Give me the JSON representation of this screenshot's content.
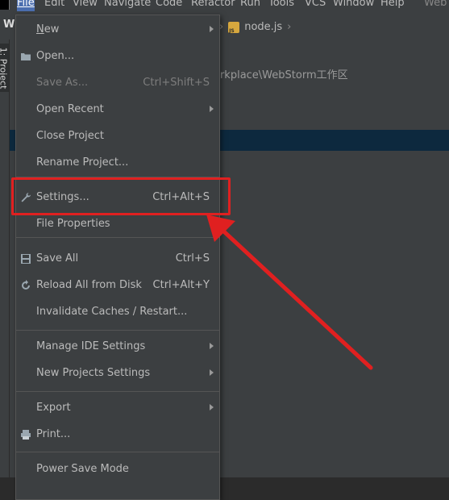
{
  "menubar": {
    "items": [
      "File",
      "Edit",
      "View",
      "Navigate",
      "Code",
      "Refactor",
      "Run",
      "Tools",
      "VCS",
      "Window",
      "Help"
    ],
    "app_title_fragment": "Web"
  },
  "toolbar": {
    "project_letter": "W",
    "breadcrumb_file": "node.js"
  },
  "tool_window": {
    "project_tab": "1: Project"
  },
  "project_panel": {
    "path_fragment": "orkplace\\WebStorm工作区"
  },
  "file_menu": {
    "items": [
      {
        "label": "New"
      },
      {
        "label": "Open..."
      },
      {
        "label": "Save As...",
        "shortcut": "Ctrl+Shift+S"
      },
      {
        "label": "Open Recent"
      },
      {
        "label": "Close Project"
      },
      {
        "label": "Rename Project..."
      },
      {
        "label": "Settings...",
        "shortcut": "Ctrl+Alt+S"
      },
      {
        "label": "File Properties"
      },
      {
        "label": "Save All",
        "shortcut": "Ctrl+S"
      },
      {
        "label": "Reload All from Disk",
        "shortcut": "Ctrl+Alt+Y"
      },
      {
        "label": "Invalidate Caches / Restart..."
      },
      {
        "label": "Manage IDE Settings"
      },
      {
        "label": "New Projects Settings"
      },
      {
        "label": "Export"
      },
      {
        "label": "Print..."
      },
      {
        "label": "Power Save Mode"
      }
    ]
  },
  "colors": {
    "annotation": "#e02020",
    "menu_active": "#4b6eaf",
    "selection": "#0d293e"
  }
}
